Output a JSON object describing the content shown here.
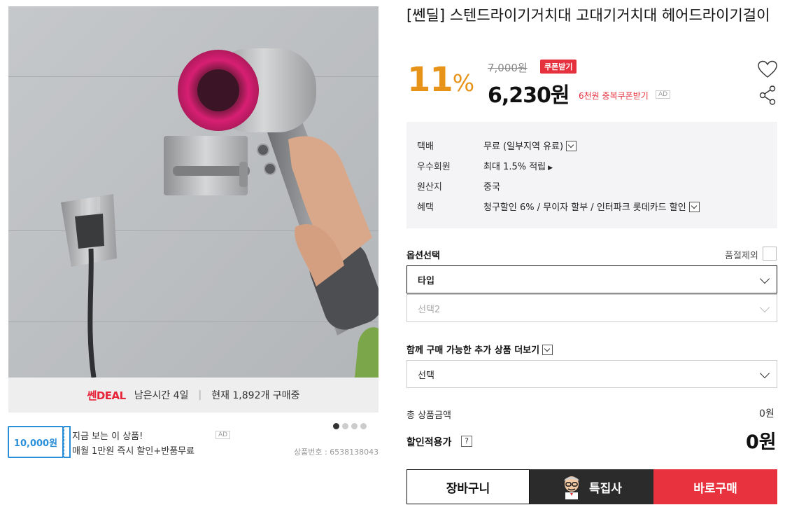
{
  "product": {
    "title": "[쎈딜] 스텐드라이기거치대 고대기거치대 헤어드라이기걸이",
    "discount_percent": "11",
    "percent_sign": "%",
    "original_price": "7,000원",
    "coupon_button": "쿠폰받기",
    "price": "6,230원",
    "price_note": "6천원 중복쿠폰받기",
    "ad_badge": "AD",
    "product_number": "상품번호 : 6538138043"
  },
  "deal_bar": {
    "logo": "쎈DEAL",
    "remaining": "남은시간 4일",
    "separator": "|",
    "purchases": "현재 1,892개 구매중"
  },
  "coupon_ad": {
    "amount": "10,000원",
    "line1": "지금 보는 이 상품!",
    "line2": "매월 1만원 즉시 할인+반품무료",
    "badge": "AD"
  },
  "carousel": {
    "total": 4,
    "active": 1
  },
  "info": {
    "rows": [
      {
        "key": "택배",
        "value": "무료 (일부지역 유료)"
      },
      {
        "key": "우수회원",
        "value": "최대 1.5% 적립"
      },
      {
        "key": "원산지",
        "value": "중국"
      },
      {
        "key": "혜택",
        "value": "청구할인 6% / 무이자 할부 / 인터파크 롯데카드 할인"
      }
    ]
  },
  "options": {
    "label": "옵션선택",
    "soldout_label": "품절제외",
    "select1": "타입",
    "select2": "선택2",
    "addon_label": "함께 구매 가능한 추가 상품 더보기",
    "addon_select": "선택"
  },
  "totals": {
    "total_label": "총 상품금액",
    "total_value": "0원",
    "discount_label": "할인적용가",
    "question": "?",
    "discount_value": "0원"
  },
  "buttons": {
    "cart": "장바구니",
    "special": "특집사",
    "buy": "바로구매"
  },
  "colors": {
    "accent_orange": "#e7931a",
    "accent_red": "#e5303e",
    "dark": "#2b2b2b",
    "coupon_blue": "#2a8fd8"
  }
}
